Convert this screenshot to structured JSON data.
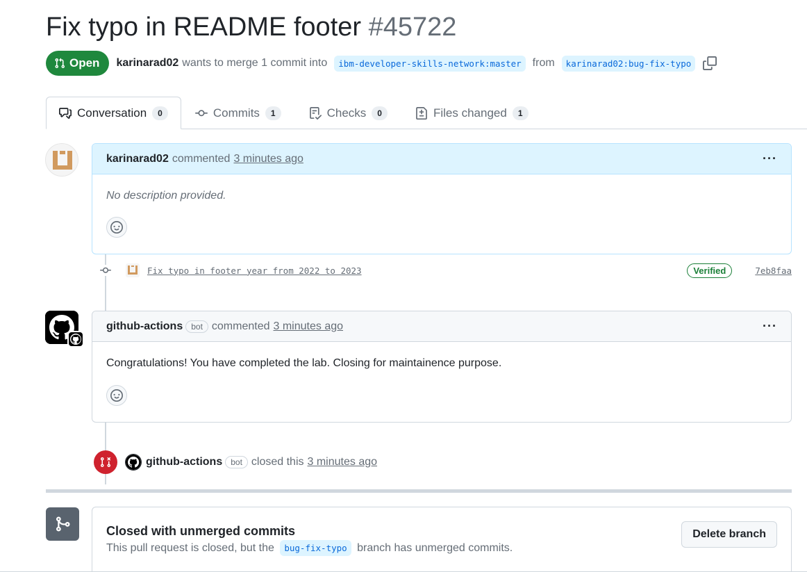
{
  "pr": {
    "title": "Fix typo in README footer",
    "number": "#45722",
    "state": "Open",
    "author": "karinarad02",
    "merge_text": "wants to merge 1 commit into",
    "base_branch": "ibm-developer-skills-network:master",
    "from_text": "from",
    "head_branch": "karinarad02:bug-fix-typo"
  },
  "tabs": [
    {
      "label": "Conversation",
      "count": "0",
      "icon": "comment-discussion-icon"
    },
    {
      "label": "Commits",
      "count": "1",
      "icon": "git-commit-icon"
    },
    {
      "label": "Checks",
      "count": "0",
      "icon": "checklist-icon"
    },
    {
      "label": "Files changed",
      "count": "1",
      "icon": "file-diff-icon"
    }
  ],
  "comments": [
    {
      "author": "karinarad02",
      "action": "commented",
      "time": "3 minutes ago",
      "body": "No description provided."
    },
    {
      "author": "github-actions",
      "badge": "bot",
      "action": "commented",
      "time": "3 minutes ago",
      "body": "Congratulations! You have completed the lab. Closing for maintainence purpose."
    }
  ],
  "commit": {
    "message": "Fix typo in footer year from 2022 to 2023",
    "verified": "Verified",
    "sha": "7eb8faa"
  },
  "closed_event": {
    "author": "github-actions",
    "badge": "bot",
    "action": "closed this",
    "time": "3 minutes ago"
  },
  "merge_box": {
    "title": "Closed with unmerged commits",
    "desc_before": "This pull request is closed, but the",
    "branch": "bug-fix-typo",
    "desc_after": "branch has unmerged commits.",
    "delete_label": "Delete branch"
  },
  "colors": {
    "open_green": "#1f883d",
    "closed_red": "#cf222e",
    "link_blue": "#0969da",
    "author_header_bg": "#ddf4ff"
  }
}
